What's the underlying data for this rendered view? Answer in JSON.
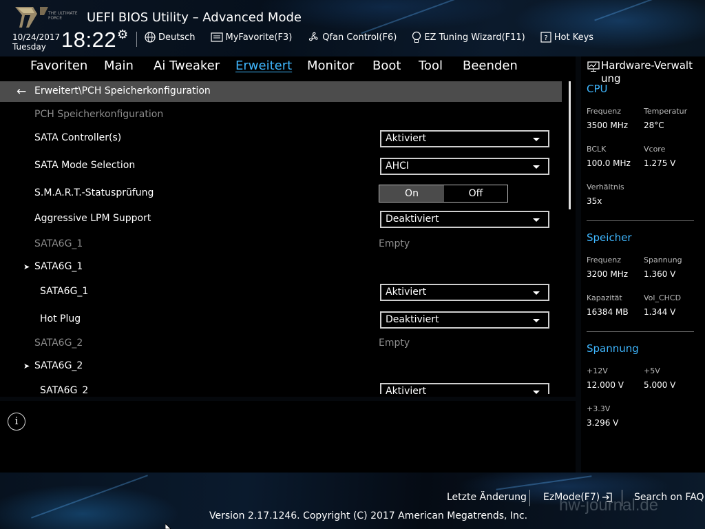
{
  "header": {
    "title": "UEFI BIOS Utility – Advanced Mode",
    "date": "10/24/2017",
    "weekday": "Tuesday",
    "time": "18:22",
    "logo_text": "THE ULTIMATE FORCE",
    "tools": [
      {
        "icon": "globe-icon",
        "label": "Deutsch"
      },
      {
        "icon": "myfavorite-icon",
        "label": "MyFavorite(F3)"
      },
      {
        "icon": "fan-icon",
        "label": "Qfan Control(F6)"
      },
      {
        "icon": "lightbulb-icon",
        "label": "EZ Tuning Wizard(F11)"
      },
      {
        "icon": "hotkeys-icon",
        "label": "Hot Keys"
      }
    ]
  },
  "nav": {
    "tabs": [
      "Favoriten",
      "Main",
      "Ai Tweaker",
      "Erweitert",
      "Monitor",
      "Boot",
      "Tool",
      "Beenden"
    ],
    "active": "Erweitert"
  },
  "breadcrumb": "Erweitert\\PCH Speicherkonfiguration",
  "section_heading": "PCH Speicherkonfiguration",
  "settings": {
    "sata_controller": {
      "label": "SATA Controller(s)",
      "value": "Aktiviert"
    },
    "sata_mode": {
      "label": "SATA Mode Selection",
      "value": "AHCI"
    },
    "smart": {
      "label": "S.M.A.R.T.-Statusprüfung",
      "on": "On",
      "off": "Off"
    },
    "lpm": {
      "label": "Aggressive LPM Support",
      "value": "Deaktiviert"
    },
    "port1_info": {
      "label": "SATA6G_1",
      "value": "Empty"
    },
    "port1_group": {
      "label": "SATA6G_1"
    },
    "port1_enable": {
      "label": "SATA6G_1",
      "value": "Aktiviert"
    },
    "port1_hotplug": {
      "label": "Hot Plug",
      "value": "Deaktiviert"
    },
    "port2_info": {
      "label": "SATA6G_2",
      "value": "Empty"
    },
    "port2_group": {
      "label": "SATA6G_2"
    },
    "port2_enable": {
      "label": "SATA6G_2",
      "value": "Aktiviert"
    }
  },
  "hw": {
    "title": "Hardware-Verwaltung",
    "cpu": {
      "heading": "CPU",
      "freq_label": "Frequenz",
      "freq": "3500 MHz",
      "temp_label": "Temperatur",
      "temp": "28°C",
      "bclk_label": "BCLK",
      "bclk": "100.0 MHz",
      "vcore_label": "Vcore",
      "vcore": "1.275 V",
      "ratio_label": "Verhältnis",
      "ratio": "35x"
    },
    "mem": {
      "heading": "Speicher",
      "freq_label": "Frequenz",
      "freq": "3200 MHz",
      "volt_label": "Spannung",
      "volt": "1.360 V",
      "cap_label": "Kapazität",
      "cap": "16384 MB",
      "chcd_label": "Vol_CHCD",
      "chcd": "1.344 V"
    },
    "volt": {
      "heading": "Spannung",
      "v12_label": "+12V",
      "v12": "12.000 V",
      "v5_label": "+5V",
      "v5": "5.000 V",
      "v33_label": "+3.3V",
      "v33": "3.296 V"
    }
  },
  "footer": {
    "last_change": "Letzte Änderung",
    "ezmode": "EzMode(F7)",
    "faq": "Search on FAQ",
    "copyright": "Version 2.17.1246. Copyright (C) 2017 American Megatrends, Inc.",
    "watermark": "hw-journal.de"
  }
}
